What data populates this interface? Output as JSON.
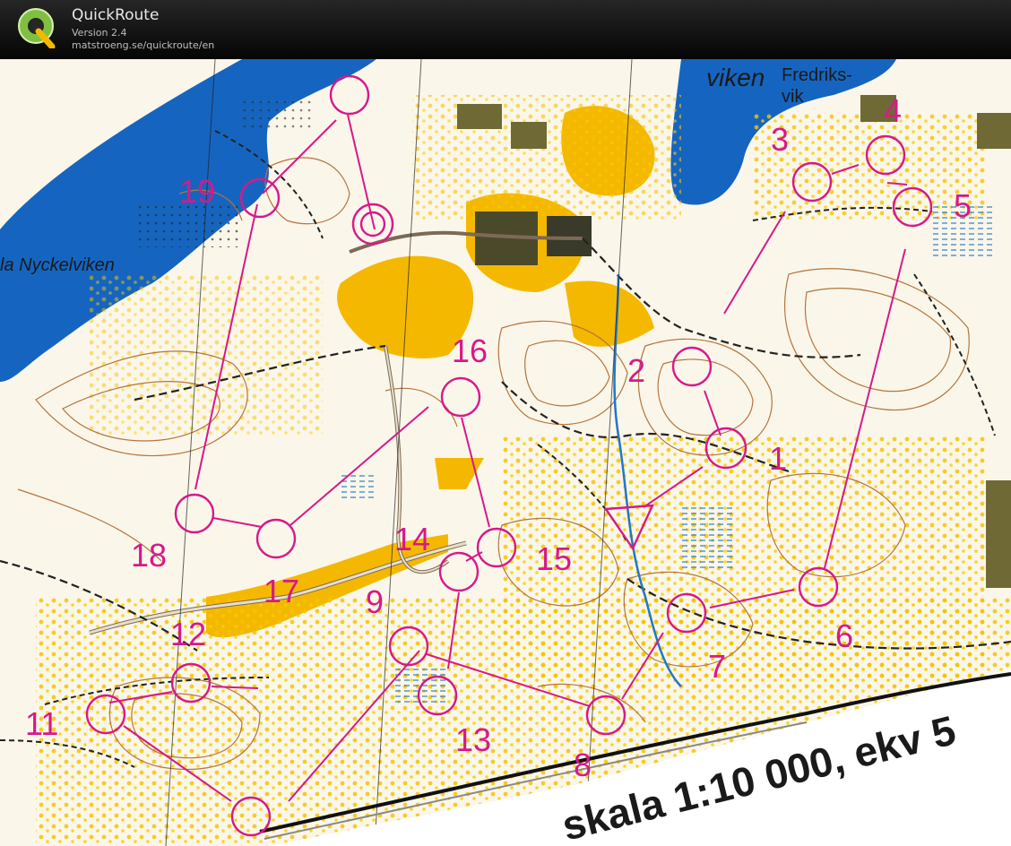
{
  "app": {
    "title": "QuickRoute",
    "version": "Version 2.4",
    "url": "matstroeng.se/quickroute/en",
    "logo_letter": "Q"
  },
  "map": {
    "labels": {
      "viken": "viken",
      "fredriksvik_1": "Fredriks-",
      "fredriksvik_2": "vik",
      "nyckelviken": "la Nyckelviken",
      "scale": "skala 1:10 000, ekv 5"
    },
    "colors": {
      "water": "#1565c0",
      "open_land": "#f5b800",
      "building": "#6f6a35",
      "course": "#d6198a",
      "contour": "#b5753e"
    }
  },
  "course": {
    "controls": [
      {
        "number": "1"
      },
      {
        "number": "2"
      },
      {
        "number": "3"
      },
      {
        "number": "4"
      },
      {
        "number": "5"
      },
      {
        "number": "6"
      },
      {
        "number": "7"
      },
      {
        "number": "8"
      },
      {
        "number": "9"
      },
      {
        "number": "11"
      },
      {
        "number": "12"
      },
      {
        "number": "13"
      },
      {
        "number": "14"
      },
      {
        "number": "15"
      },
      {
        "number": "16"
      },
      {
        "number": "17"
      },
      {
        "number": "18"
      },
      {
        "number": "19"
      }
    ]
  }
}
